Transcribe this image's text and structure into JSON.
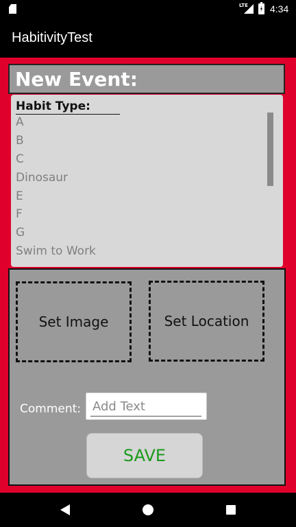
{
  "status_bar": {
    "network": "LTE",
    "time": "4:34"
  },
  "app_bar": {
    "title": "HabitivityTest"
  },
  "header": {
    "title": "New Event:"
  },
  "habit_list": {
    "label": "Habit Type:",
    "items": [
      "A",
      "B",
      "C",
      "Dinosaur",
      "E",
      "F",
      "G",
      "Swim to Work"
    ]
  },
  "panel": {
    "set_image_label": "Set Image",
    "set_location_label": "Set Location",
    "comment_label": "Comment:",
    "comment_placeholder": "Add Text",
    "save_label": "SAVE"
  },
  "colors": {
    "background_accent": "#e0002c",
    "panel": "#9a9a9a",
    "save_text": "#1a9a1a"
  }
}
